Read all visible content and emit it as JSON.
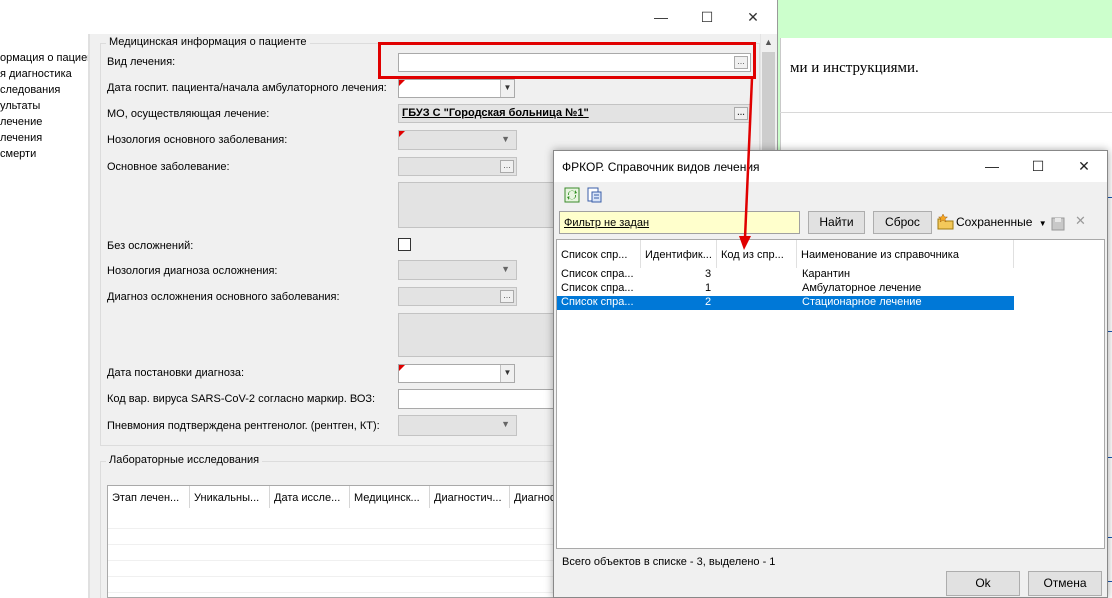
{
  "background_page": {
    "text": "ми и инструкциями."
  },
  "main_window": {
    "minimize": "—",
    "maximize": "☐",
    "close": "✕",
    "tree_items": [
      "ормация о пациен",
      "я диагностика",
      "следования",
      "ультаты",
      "лечение",
      "лечения",
      "смерти"
    ],
    "medical_group_title": "Медицинская информация о пациенте",
    "fields": {
      "treatment_type": {
        "label": "Вид лечения:",
        "value": ""
      },
      "hosp_date": {
        "label": "Дата госпит. пациента/начала амбулаторного лечения:",
        "value": ""
      },
      "mo": {
        "label": "МО, осуществляющая лечение:",
        "value": "ГБУЗ С \"Городская больница №1\""
      },
      "nosology": {
        "label": "Нозология основного заболевания:",
        "value": ""
      },
      "main_disease": {
        "label": "Основное заболевание:",
        "value": ""
      },
      "no_complications": {
        "label": "Без осложнений:",
        "checked": false
      },
      "complication_nosology": {
        "label": "Нозология диагноза осложнения:",
        "value": ""
      },
      "complication_diagnosis": {
        "label": "Диагноз осложнения основного заболевания:",
        "value": ""
      },
      "diagnosis_date": {
        "label": "Дата постановки диагноза:",
        "value": ""
      },
      "virus_code": {
        "label": "Код вар. вируса SARS-CoV-2 согласно маркир. ВОЗ:",
        "value": ""
      },
      "pneumonia": {
        "label": "Пневмония подтверждена рентгенолог. (рентген, КТ):",
        "value": ""
      }
    },
    "lab_group_title": "Лабораторные исследования",
    "lab_columns": [
      "Этап лечен...",
      "Уникальны...",
      "Дата иссле...",
      "Медицинск...",
      "Диагностич...",
      "Диагност"
    ]
  },
  "dialog": {
    "title": "ФРКОР. Справочник видов лечения",
    "minimize": "—",
    "maximize": "☐",
    "close": "✕",
    "filter_text": "Фильтр не задан",
    "find_button": "Найти",
    "reset_button": "Сброс",
    "saved_label": "Сохраненные",
    "columns": [
      "Список спр...",
      "Идентифик...",
      "Код из спр...",
      "Наименование из справочника"
    ],
    "rows": [
      {
        "list": "Список спра...",
        "id": "",
        "code": "3",
        "name": "Карантин",
        "selected": false
      },
      {
        "list": "Список спра...",
        "id": "",
        "code": "1",
        "name": "Амбулаторное лечение",
        "selected": false
      },
      {
        "list": "Список спра...",
        "id": "",
        "code": "2",
        "name": "Стационарное лечение",
        "selected": true
      }
    ],
    "status": "Всего объектов в списке - 3, выделено - 1",
    "ok_button": "Ok",
    "cancel_button": "Отмена"
  },
  "colors": {
    "highlight_red": "#e00000",
    "selection_blue": "#0078d7",
    "filter_yellow": "#ffffcc",
    "background_green": "#ccffcc"
  }
}
